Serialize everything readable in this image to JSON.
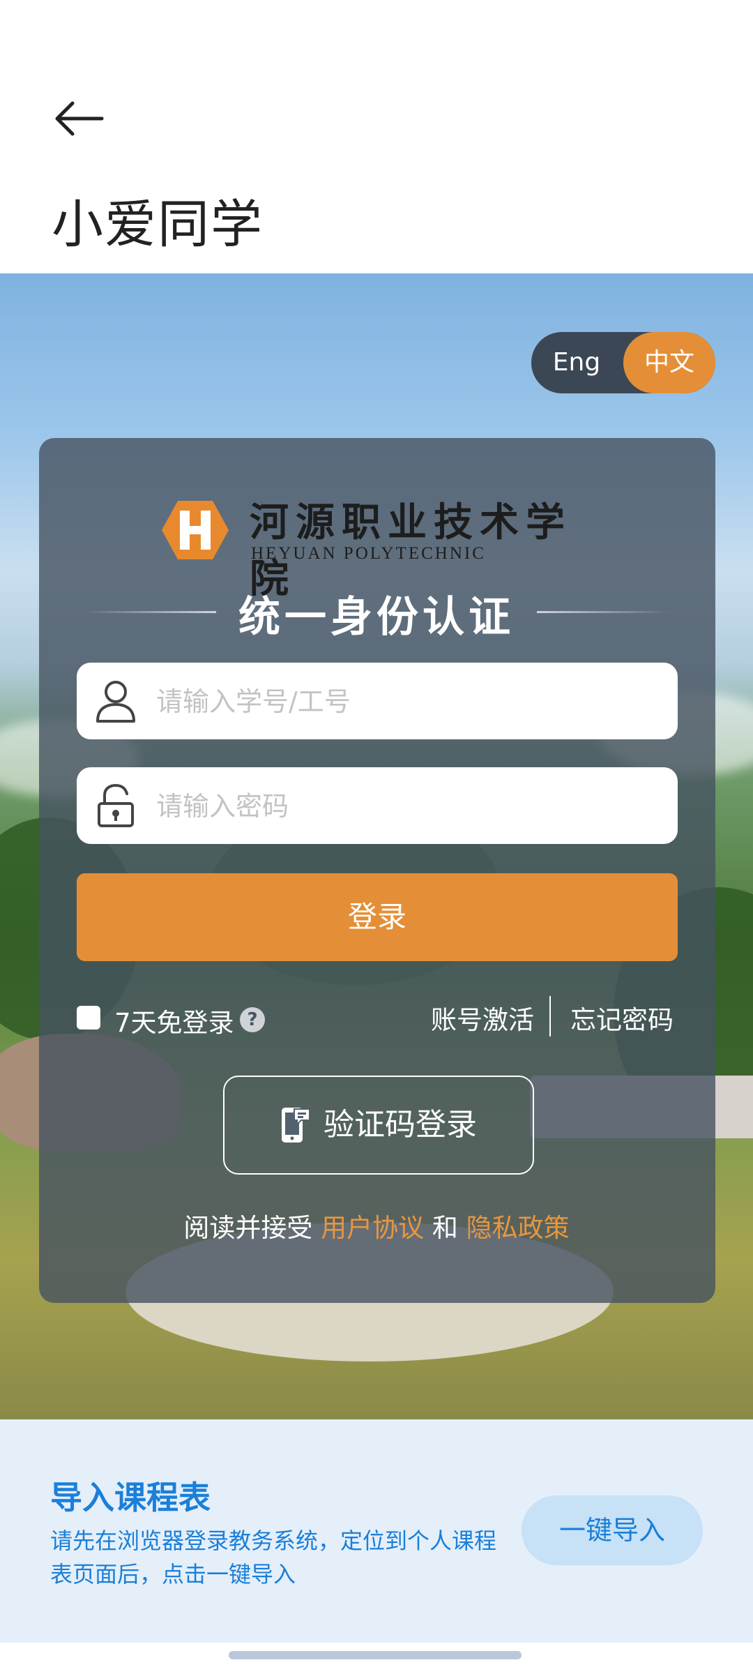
{
  "header": {
    "title": "小爱同学"
  },
  "language_toggle": {
    "english": "Eng",
    "chinese": "中文",
    "selected": "中文"
  },
  "login_card": {
    "logo_chinese": "河源职业技术学院",
    "logo_english": "HEYUAN POLYTECHNIC",
    "heading": "统一身份认证",
    "username_placeholder": "请输入学号/工号",
    "password_placeholder": "请输入密码",
    "login_button": "登录",
    "remember_label": "7天免登录",
    "help_icon_text": "?",
    "activate_account": "账号激活",
    "forgot_password": "忘记密码",
    "sms_login": "验证码登录",
    "agreement_prefix": "阅读并接受",
    "user_agreement": "用户协议",
    "agreement_and": "和",
    "privacy_policy": "隐私政策"
  },
  "import_panel": {
    "title": "导入课程表",
    "description": "请先在浏览器登录教务系统，定位到个人课程表页面后，点击一键导入",
    "button": "一键导入"
  },
  "colors": {
    "accent": "#e48f37",
    "link_blue": "#1a7fd9",
    "card": "#465260",
    "panel": "#e4effa"
  }
}
